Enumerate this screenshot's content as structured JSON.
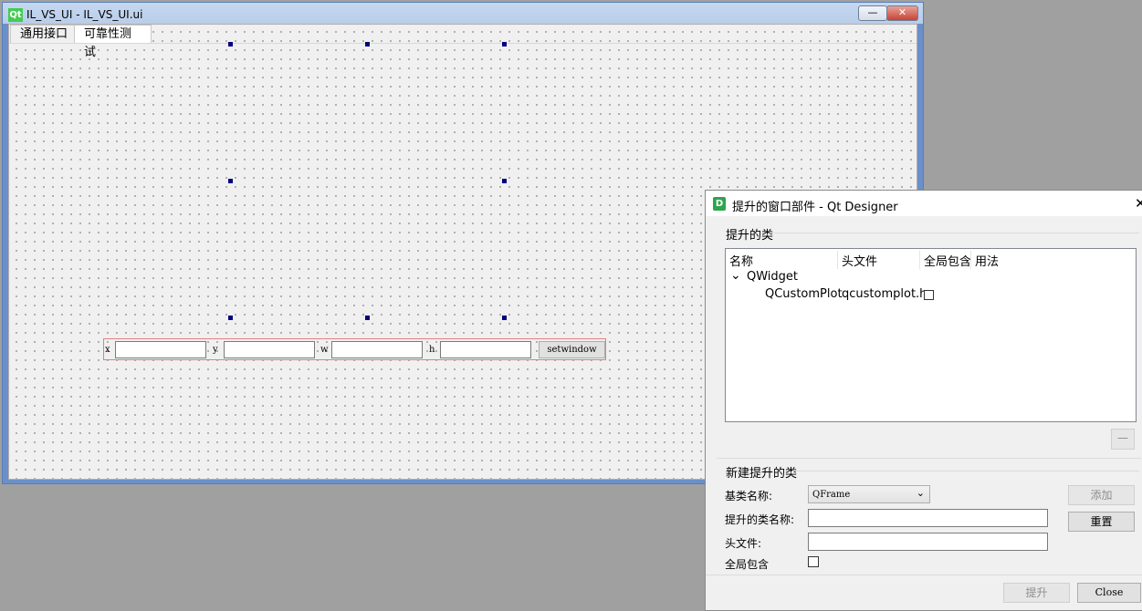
{
  "form_window": {
    "title": "IL_VS_UI - IL_VS_UI.ui",
    "qt_logo_text": "Qt",
    "minimize_glyph": "—",
    "close_glyph": "✕",
    "tabs": [
      {
        "label": "通用接口",
        "active": false
      },
      {
        "label": "可靠性测试",
        "active": true
      }
    ],
    "setwindow": {
      "x_label": "x",
      "y_label": "y",
      "w_label": "w",
      "h_label": "h",
      "x_value": "",
      "y_value": "",
      "w_value": "",
      "h_value": "",
      "button_label": "setwindow"
    }
  },
  "dialog": {
    "title": "提升的窗口部件 - Qt Designer",
    "icon_text": "D",
    "close_glyph": "✕",
    "promoted_group": {
      "title": "提升的类",
      "columns": [
        "名称",
        "头文件",
        "全局包含",
        "用法"
      ],
      "parent_class": "QWidget",
      "expand_glyph": "⌄",
      "rows": [
        {
          "name": "QCustomPlot",
          "header": "qcustomplot.h",
          "global_include": false,
          "usage": ""
        }
      ],
      "remove_button": "—"
    },
    "new_group": {
      "title": "新建提升的类",
      "base_class_label": "基类名称:",
      "base_class_value": "QFrame",
      "promoted_name_label": "提升的类名称:",
      "promoted_name_value": "",
      "header_label": "头文件:",
      "header_value": "",
      "global_include_label": "全局包含",
      "global_include_checked": false,
      "add_button": "添加",
      "reset_button": "重置"
    },
    "footer": {
      "promote_button": "提升",
      "close_button": "Close"
    }
  },
  "colors": {
    "handle": "#000080",
    "layout_border": "#e08080",
    "qt_green": "#41cd52",
    "designer_green": "#2da44e"
  }
}
